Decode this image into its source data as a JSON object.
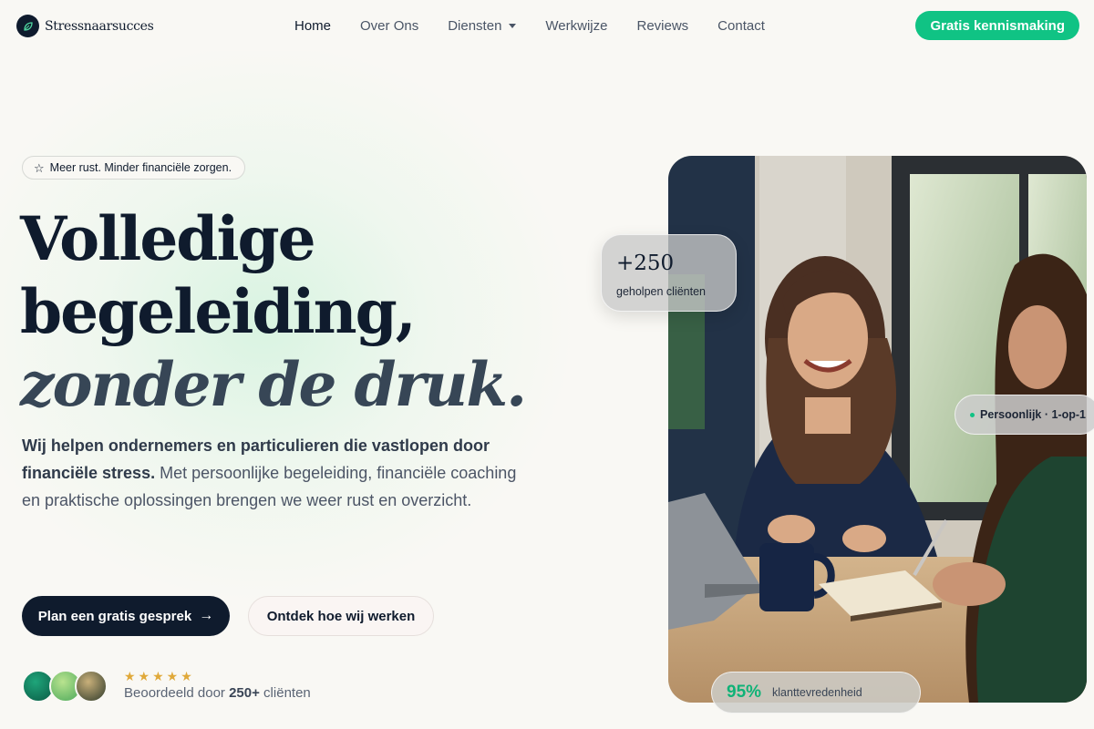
{
  "brand": {
    "name": "Stressnaarsucces",
    "logo_icon": "leaf-icon"
  },
  "nav": {
    "links": [
      {
        "label": "Home",
        "active": true
      },
      {
        "label": "Over Ons"
      },
      {
        "label": "Diensten",
        "dropdown": true
      },
      {
        "label": "Werkwijze"
      },
      {
        "label": "Reviews"
      },
      {
        "label": "Contact"
      }
    ],
    "cta": "Gratis kennismaking"
  },
  "colors": {
    "accent": "#10c384",
    "navy": "#0f1b2d",
    "star": "#e0a93a"
  },
  "hero": {
    "badge": "Meer rust. Minder financiële zorgen.",
    "badge_icon": "star-outline-icon",
    "headline_line1": "Volledige",
    "headline_line2": "begeleiding,",
    "headline_line3": "zonder de druk.",
    "lead_bold": "Wij helpen ondernemers en particulieren die vastlopen door financiële stress.",
    "lead_rest": " Met persoonlijke begeleiding, financiële coaching en praktische oplossingen brengen we weer rust en overzicht.",
    "primary_button": "Plan een gratis gesprek",
    "primary_button_icon": "arrow-right-icon",
    "secondary_button": "Ontdek hoe wij werken",
    "stars": "★★★★★",
    "rating": 5,
    "rated_prefix": "Beoordeeld door ",
    "rated_count": "250+",
    "rated_suffix": " cliënten"
  },
  "stats": {
    "clients_number": "+250",
    "clients_label": "geholpen cliënten",
    "personal_label": "Persoonlijk · 1-op-1",
    "satisfaction_pct": "95%",
    "satisfaction_label": "klanttevredenheid"
  }
}
